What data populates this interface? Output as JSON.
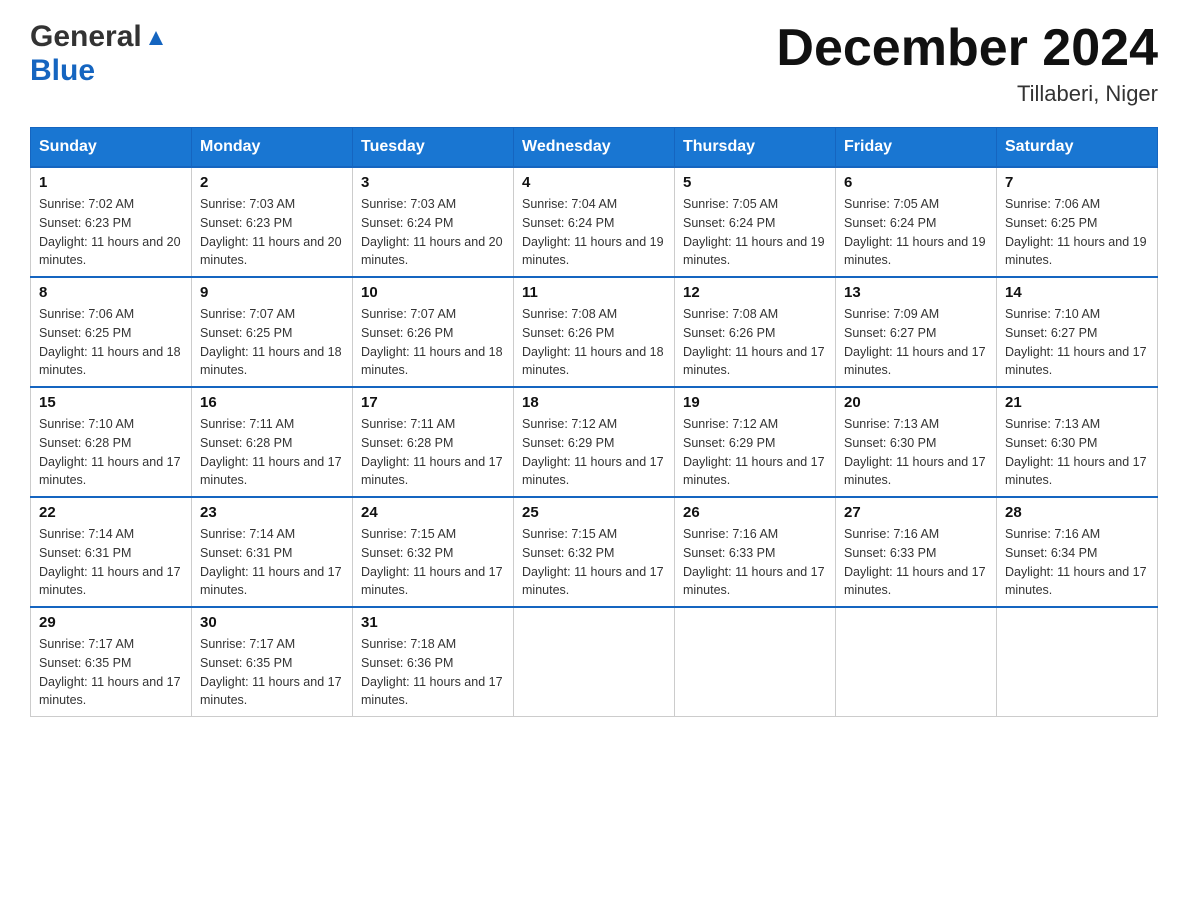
{
  "header": {
    "logo_general": "General",
    "logo_blue": "Blue",
    "month_title": "December 2024",
    "location": "Tillaberi, Niger"
  },
  "days_of_week": [
    "Sunday",
    "Monday",
    "Tuesday",
    "Wednesday",
    "Thursday",
    "Friday",
    "Saturday"
  ],
  "weeks": [
    [
      {
        "day": "1",
        "sunrise": "7:02 AM",
        "sunset": "6:23 PM",
        "daylight": "11 hours and 20 minutes."
      },
      {
        "day": "2",
        "sunrise": "7:03 AM",
        "sunset": "6:23 PM",
        "daylight": "11 hours and 20 minutes."
      },
      {
        "day": "3",
        "sunrise": "7:03 AM",
        "sunset": "6:24 PM",
        "daylight": "11 hours and 20 minutes."
      },
      {
        "day": "4",
        "sunrise": "7:04 AM",
        "sunset": "6:24 PM",
        "daylight": "11 hours and 19 minutes."
      },
      {
        "day": "5",
        "sunrise": "7:05 AM",
        "sunset": "6:24 PM",
        "daylight": "11 hours and 19 minutes."
      },
      {
        "day": "6",
        "sunrise": "7:05 AM",
        "sunset": "6:24 PM",
        "daylight": "11 hours and 19 minutes."
      },
      {
        "day": "7",
        "sunrise": "7:06 AM",
        "sunset": "6:25 PM",
        "daylight": "11 hours and 19 minutes."
      }
    ],
    [
      {
        "day": "8",
        "sunrise": "7:06 AM",
        "sunset": "6:25 PM",
        "daylight": "11 hours and 18 minutes."
      },
      {
        "day": "9",
        "sunrise": "7:07 AM",
        "sunset": "6:25 PM",
        "daylight": "11 hours and 18 minutes."
      },
      {
        "day": "10",
        "sunrise": "7:07 AM",
        "sunset": "6:26 PM",
        "daylight": "11 hours and 18 minutes."
      },
      {
        "day": "11",
        "sunrise": "7:08 AM",
        "sunset": "6:26 PM",
        "daylight": "11 hours and 18 minutes."
      },
      {
        "day": "12",
        "sunrise": "7:08 AM",
        "sunset": "6:26 PM",
        "daylight": "11 hours and 17 minutes."
      },
      {
        "day": "13",
        "sunrise": "7:09 AM",
        "sunset": "6:27 PM",
        "daylight": "11 hours and 17 minutes."
      },
      {
        "day": "14",
        "sunrise": "7:10 AM",
        "sunset": "6:27 PM",
        "daylight": "11 hours and 17 minutes."
      }
    ],
    [
      {
        "day": "15",
        "sunrise": "7:10 AM",
        "sunset": "6:28 PM",
        "daylight": "11 hours and 17 minutes."
      },
      {
        "day": "16",
        "sunrise": "7:11 AM",
        "sunset": "6:28 PM",
        "daylight": "11 hours and 17 minutes."
      },
      {
        "day": "17",
        "sunrise": "7:11 AM",
        "sunset": "6:28 PM",
        "daylight": "11 hours and 17 minutes."
      },
      {
        "day": "18",
        "sunrise": "7:12 AM",
        "sunset": "6:29 PM",
        "daylight": "11 hours and 17 minutes."
      },
      {
        "day": "19",
        "sunrise": "7:12 AM",
        "sunset": "6:29 PM",
        "daylight": "11 hours and 17 minutes."
      },
      {
        "day": "20",
        "sunrise": "7:13 AM",
        "sunset": "6:30 PM",
        "daylight": "11 hours and 17 minutes."
      },
      {
        "day": "21",
        "sunrise": "7:13 AM",
        "sunset": "6:30 PM",
        "daylight": "11 hours and 17 minutes."
      }
    ],
    [
      {
        "day": "22",
        "sunrise": "7:14 AM",
        "sunset": "6:31 PM",
        "daylight": "11 hours and 17 minutes."
      },
      {
        "day": "23",
        "sunrise": "7:14 AM",
        "sunset": "6:31 PM",
        "daylight": "11 hours and 17 minutes."
      },
      {
        "day": "24",
        "sunrise": "7:15 AM",
        "sunset": "6:32 PM",
        "daylight": "11 hours and 17 minutes."
      },
      {
        "day": "25",
        "sunrise": "7:15 AM",
        "sunset": "6:32 PM",
        "daylight": "11 hours and 17 minutes."
      },
      {
        "day": "26",
        "sunrise": "7:16 AM",
        "sunset": "6:33 PM",
        "daylight": "11 hours and 17 minutes."
      },
      {
        "day": "27",
        "sunrise": "7:16 AM",
        "sunset": "6:33 PM",
        "daylight": "11 hours and 17 minutes."
      },
      {
        "day": "28",
        "sunrise": "7:16 AM",
        "sunset": "6:34 PM",
        "daylight": "11 hours and 17 minutes."
      }
    ],
    [
      {
        "day": "29",
        "sunrise": "7:17 AM",
        "sunset": "6:35 PM",
        "daylight": "11 hours and 17 minutes."
      },
      {
        "day": "30",
        "sunrise": "7:17 AM",
        "sunset": "6:35 PM",
        "daylight": "11 hours and 17 minutes."
      },
      {
        "day": "31",
        "sunrise": "7:18 AM",
        "sunset": "6:36 PM",
        "daylight": "11 hours and 17 minutes."
      },
      null,
      null,
      null,
      null
    ]
  ],
  "labels": {
    "sunrise_prefix": "Sunrise: ",
    "sunset_prefix": "Sunset: ",
    "daylight_prefix": "Daylight: "
  }
}
